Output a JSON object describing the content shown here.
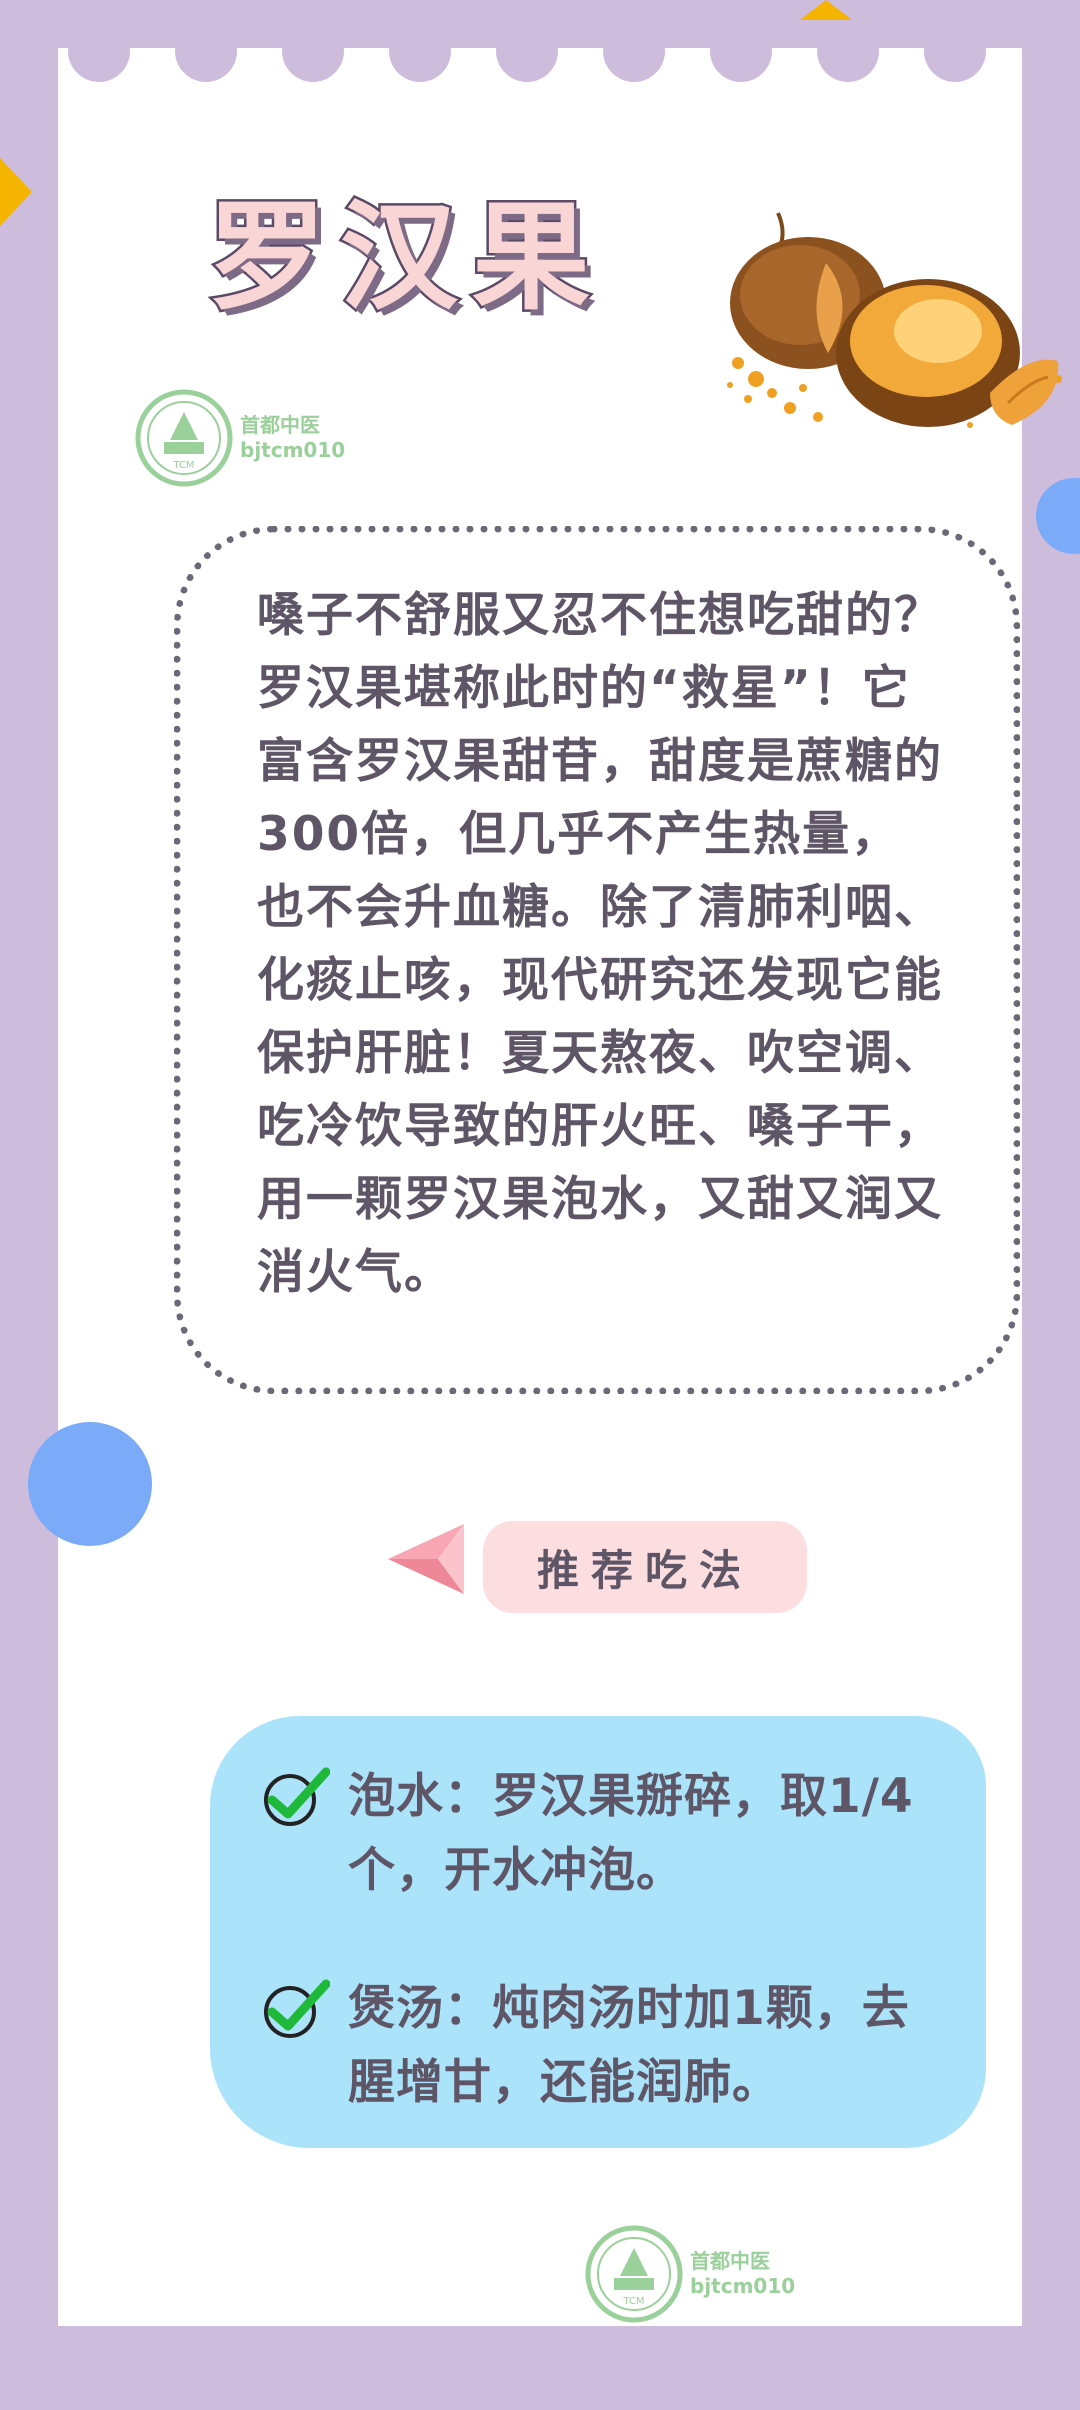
{
  "title": "罗汉果",
  "logo": {
    "name": "首都中医",
    "handle": "bjtcm010",
    "seal_text": "TCM"
  },
  "intro": "嗓子不舒服又忍不住想吃甜的？罗汉果堪称此时的“救星”！它富含罗汉果甜苷，甜度是蔗糖的300倍，但几乎不产生热量，也不会升血糖。除了清肺利咽、化痰止咳，现代研究还发现它能保护肝脏！夏天熬夜、吹空调、吃冷饮导致的肝火旺、嗓子干，用一颗罗汉果泡水，又甜又润又消火气。",
  "section_title": "推荐吃法",
  "tips": [
    {
      "text": "泡水：罗汉果掰碎，取1/4个，开水冲泡。"
    },
    {
      "text": "煲汤：炖肉汤时加1颗，去腥增甘，还能润肺。"
    }
  ],
  "colors": {
    "frame": "#cdbcdc",
    "card": "#ffffff",
    "accent_blue": "#7aaaf8",
    "accent_yellow": "#f4b400",
    "title_fill": "#f9d5d6",
    "pill": "#fcdde0",
    "tips_bg": "#abe3fb",
    "check": "#1fb83a",
    "text": "#5e5667"
  },
  "icons": [
    "paper-plane-icon",
    "check-icon",
    "tcm-seal-icon",
    "luo-han-guo-illustration"
  ]
}
